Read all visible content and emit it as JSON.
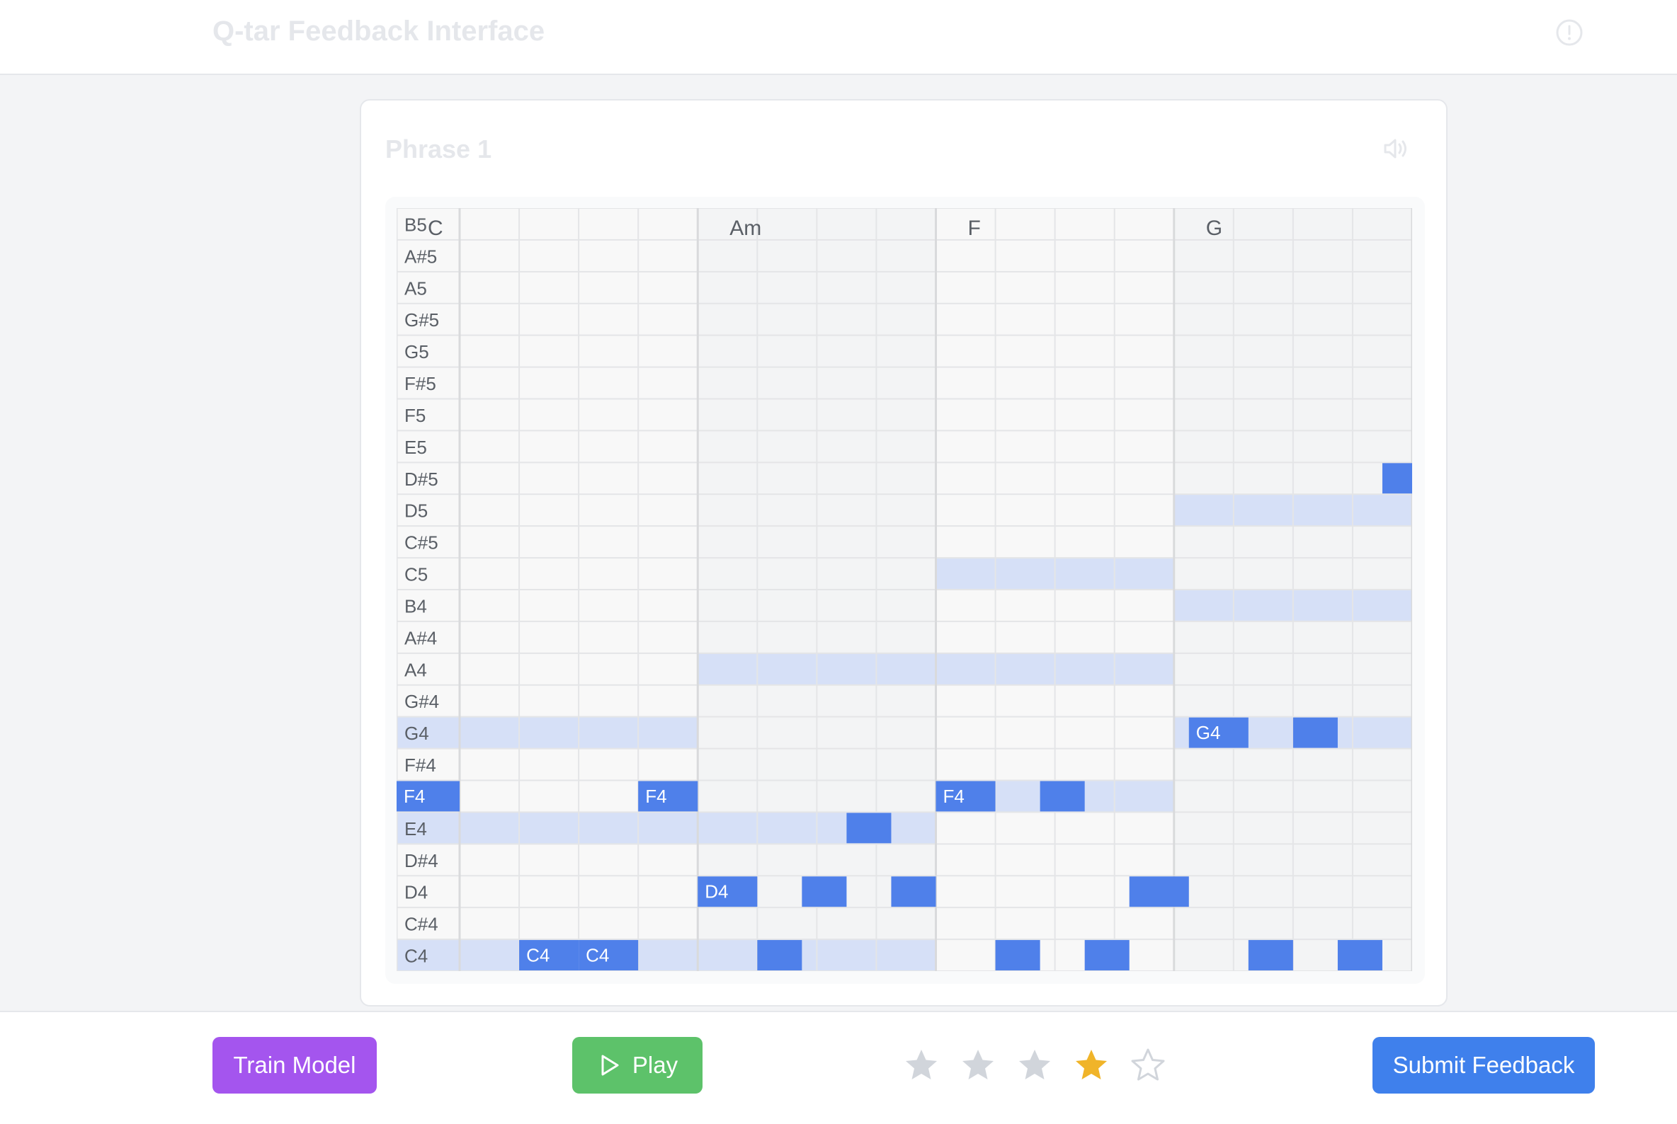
{
  "header": {
    "title": "Q-tar Feedback Interface",
    "alert_icon": "alert-circle-icon"
  },
  "phrase": {
    "title": "Phrase 1",
    "speaker_icon": "volume-icon"
  },
  "piano_roll": {
    "pitches": [
      "B5",
      "A#5",
      "A5",
      "G#5",
      "G5",
      "F#5",
      "F5",
      "E5",
      "D#5",
      "D5",
      "C#5",
      "C5",
      "B4",
      "A#4",
      "A4",
      "G#4",
      "G4",
      "F#4",
      "F4",
      "E4",
      "D#4",
      "D4",
      "C#4",
      "C4"
    ],
    "beats_per_bar": 4,
    "bars": [
      {
        "chord": "C",
        "chord_tones": [
          "G4",
          "E4",
          "C4"
        ]
      },
      {
        "chord": "Am",
        "chord_tones": [
          "A4",
          "E4",
          "C4"
        ]
      },
      {
        "chord": "F",
        "chord_tones": [
          "C5",
          "A4",
          "F4"
        ]
      },
      {
        "chord": "G",
        "chord_tones": [
          "D5",
          "B4",
          "G4"
        ]
      }
    ],
    "notes": [
      {
        "pitch": "F4",
        "start": 0,
        "duration": 1,
        "label": "F4"
      },
      {
        "pitch": "C4",
        "start": 1,
        "duration": 1,
        "label": "C4"
      },
      {
        "pitch": "C4",
        "start": 2,
        "duration": 1,
        "label": "C4"
      },
      {
        "pitch": "F4",
        "start": 3,
        "duration": 1,
        "label": "F4"
      },
      {
        "pitch": "D4",
        "start": 4,
        "duration": 1,
        "label": "D4"
      },
      {
        "pitch": "C4",
        "start": 5,
        "duration": 0.75,
        "label": ""
      },
      {
        "pitch": "D4",
        "start": 5.75,
        "duration": 0.75,
        "label": ""
      },
      {
        "pitch": "E4",
        "start": 6.5,
        "duration": 0.75,
        "label": ""
      },
      {
        "pitch": "D4",
        "start": 7.25,
        "duration": 0.75,
        "label": ""
      },
      {
        "pitch": "F4",
        "start": 8,
        "duration": 1,
        "label": "F4"
      },
      {
        "pitch": "C4",
        "start": 9,
        "duration": 0.75,
        "label": ""
      },
      {
        "pitch": "F4",
        "start": 9.75,
        "duration": 0.75,
        "label": ""
      },
      {
        "pitch": "C4",
        "start": 10.5,
        "duration": 0.75,
        "label": ""
      },
      {
        "pitch": "D4",
        "start": 11.25,
        "duration": 1,
        "label": ""
      },
      {
        "pitch": "G4",
        "start": 12.25,
        "duration": 1,
        "label": "G4"
      },
      {
        "pitch": "C4",
        "start": 13.25,
        "duration": 0.75,
        "label": ""
      },
      {
        "pitch": "G4",
        "start": 14,
        "duration": 0.75,
        "label": ""
      },
      {
        "pitch": "C4",
        "start": 14.75,
        "duration": 0.75,
        "label": ""
      },
      {
        "pitch": "D#5",
        "start": 15.5,
        "duration": 0.5,
        "label": ""
      }
    ],
    "colors": {
      "note": "#4f80ea",
      "chord_tone": "#d6e0f7",
      "grid_bg": "#f8f8f8",
      "grid_bg_alt": "#f3f4f5",
      "grid_line": "#e4e5e7",
      "bar_line": "#d9dadc",
      "label": "#5a5f66"
    }
  },
  "footer": {
    "train_label": "Train Model",
    "play_label": "Play",
    "play_icon": "play-icon",
    "submit_label": "Submit Feedback",
    "rating": {
      "value": 4,
      "max": 5,
      "star_icon": "star-icon",
      "colors": {
        "active": "#f0b429",
        "inactive": "#d1d5db"
      }
    }
  }
}
